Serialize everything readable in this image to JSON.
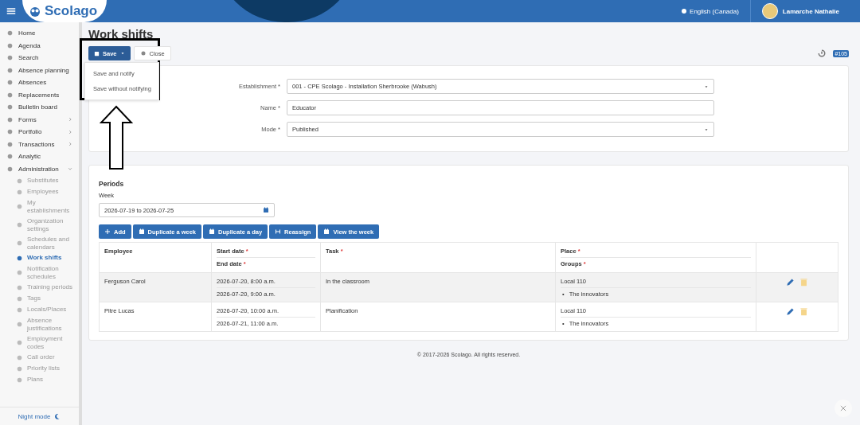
{
  "header": {
    "brand": "Scolago",
    "language": "English (Canada)",
    "user": "Lamarche Nathalie"
  },
  "sidebar": {
    "items": [
      {
        "label": "Home",
        "kind": "link",
        "selected": false
      },
      {
        "label": "Agenda",
        "kind": "link",
        "selected": false
      },
      {
        "label": "Search",
        "kind": "link",
        "selected": false
      },
      {
        "label": "Absence planning",
        "kind": "link",
        "selected": false
      },
      {
        "label": "Absences",
        "kind": "link",
        "selected": false
      },
      {
        "label": "Replacements",
        "kind": "link",
        "selected": false
      },
      {
        "label": "Bulletin board",
        "kind": "link",
        "selected": false
      },
      {
        "label": "Forms",
        "kind": "group",
        "expanded": false,
        "selected": false
      },
      {
        "label": "Portfolio",
        "kind": "group",
        "expanded": false,
        "selected": false
      },
      {
        "label": "Transactions",
        "kind": "group",
        "expanded": false,
        "selected": false
      },
      {
        "label": "Analytic",
        "kind": "link",
        "selected": false
      },
      {
        "label": "Administration",
        "kind": "group",
        "expanded": true,
        "selected": false,
        "children": [
          {
            "label": "Substitutes",
            "selected": false
          },
          {
            "label": "Employees",
            "selected": false
          },
          {
            "label": "My establishments",
            "selected": false
          },
          {
            "label": "Organization settings",
            "selected": false
          },
          {
            "label": "Schedules and calendars",
            "selected": false
          },
          {
            "label": "Work shifts",
            "selected": true
          },
          {
            "label": "Notification schedules",
            "selected": false
          },
          {
            "label": "Training periods",
            "selected": false
          },
          {
            "label": "Tags",
            "selected": false
          },
          {
            "label": "Locals/Places",
            "selected": false
          },
          {
            "label": "Absence justifications",
            "selected": false
          },
          {
            "label": "Employment codes",
            "selected": false
          },
          {
            "label": "Call order",
            "selected": false
          },
          {
            "label": "Priority lists",
            "selected": false
          },
          {
            "label": "Plans",
            "selected": false
          }
        ]
      }
    ],
    "night_mode": "Night mode"
  },
  "page": {
    "title": "Work shifts",
    "save": "Save",
    "close": "Close",
    "badge": "#105",
    "save_menu": {
      "open": true,
      "items": [
        "Save and notify",
        "Save without notifying"
      ]
    }
  },
  "form": {
    "required_mark": "*",
    "fields": [
      {
        "label": "Establishment",
        "required": true,
        "kind": "select",
        "value": "001 - CPE Scolago - Installation Sherbrooke (Wabush)"
      },
      {
        "label": "Name",
        "required": true,
        "kind": "text",
        "value": "Educator"
      },
      {
        "label": "Mode",
        "required": true,
        "kind": "select",
        "value": "Published"
      }
    ]
  },
  "periods": {
    "title": "Periods",
    "week_label": "Week",
    "week_value": "2026-07-19 to 2026-07-25",
    "buttons": [
      {
        "label": "Add",
        "kind": "plus"
      },
      {
        "label": "Duplicate a week",
        "kind": "calendar"
      },
      {
        "label": "Duplicate a day",
        "kind": "calendar"
      },
      {
        "label": "Reassign",
        "kind": "swap"
      },
      {
        "label": "View the week",
        "kind": "calendar"
      }
    ],
    "table": {
      "required_mark": "*",
      "bullet": "•",
      "columns": [
        {
          "lines": [
            "Employee"
          ],
          "required": false
        },
        {
          "lines": [
            "Start date",
            "End date"
          ],
          "required": true
        },
        {
          "lines": [
            "Task"
          ],
          "required": true
        },
        {
          "lines": [
            "Place",
            "Groups"
          ],
          "required": true
        }
      ],
      "rows": [
        {
          "employee": "Ferguson Carol",
          "start": "2026-07-20, 8:00 a.m.",
          "end": "2026-07-20, 9:00 a.m.",
          "task": "In the classroom",
          "place": "Local 110",
          "groups": [
            "The innovators"
          ],
          "selected": true
        },
        {
          "employee": "Pitre Lucas",
          "start": "2026-07-20, 10:00 a.m.",
          "end": "2026-07-21, 11:00 a.m.",
          "task": "Planification",
          "place": "Local 110",
          "groups": [
            "The innovators"
          ],
          "selected": false
        }
      ]
    }
  },
  "footer": "© 2017-2026 Scolago. All rights reserved."
}
